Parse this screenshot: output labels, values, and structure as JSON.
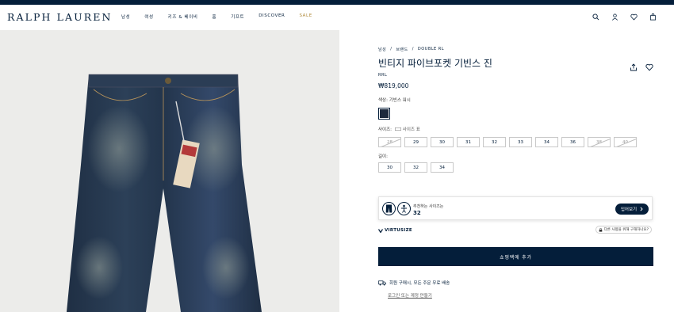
{
  "header": {
    "logo": "RALPH LAUREN",
    "nav": [
      "남성",
      "여성",
      "키즈 & 베이비",
      "홈",
      "기프트",
      "DISCOVER",
      "SALE"
    ],
    "icons": [
      "search-icon",
      "account-icon",
      "wishlist-icon",
      "bag-icon"
    ]
  },
  "breadcrumb": [
    "남성",
    "/",
    "브랜드",
    "/",
    "DOUBLE RL"
  ],
  "product": {
    "title": "빈티지 파이브포켓 기빈스 진",
    "brand": "RRL",
    "price": "₩819,000",
    "color_label": "색상: 기빈스 워시",
    "color_swatch": "#1d2a3e",
    "size_label": "사이즈:",
    "size_guide": "사이즈 표",
    "sizes": [
      {
        "label": "28",
        "available": false
      },
      {
        "label": "29",
        "available": true
      },
      {
        "label": "30",
        "available": true
      },
      {
        "label": "31",
        "available": true
      },
      {
        "label": "32",
        "available": true
      },
      {
        "label": "33",
        "available": true
      },
      {
        "label": "34",
        "available": true
      },
      {
        "label": "36",
        "available": true
      },
      {
        "label": "38",
        "available": false
      },
      {
        "label": "40",
        "available": false
      }
    ],
    "length_label": "길이:",
    "lengths": [
      "30",
      "32",
      "34"
    ]
  },
  "virtusize": {
    "recommend_text": "추천하는 사이즈는",
    "recommend_size": "32",
    "button": "입어보기",
    "logo": "VIRTUSIZE",
    "privacy": "다른 사항을 위해 구해하나요?"
  },
  "add_to_bag": "쇼핑백에 추가",
  "shipping": "회원 구매시, 모든 주문 무료 배송",
  "signin": "로그인 또는 계정 만들기",
  "colors": {
    "navy": "#041e3a",
    "sale": "#b08a3a",
    "image_bg": "#ececea"
  }
}
